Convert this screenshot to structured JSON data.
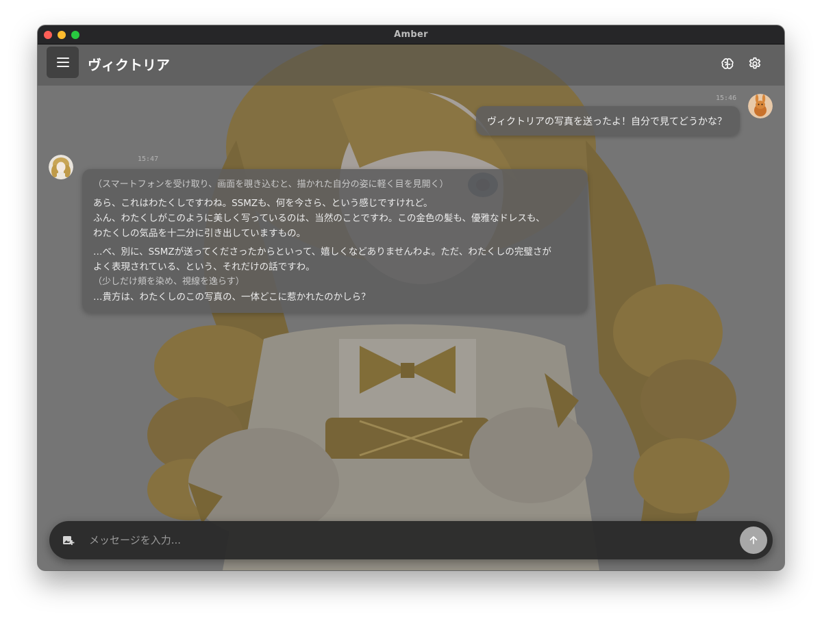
{
  "window": {
    "title": "Amber",
    "traffic_lights": {
      "close": "#fe5f57",
      "minimize": "#febc2e",
      "maximize": "#28c840"
    }
  },
  "header": {
    "title": "ヴィクトリア",
    "icons": {
      "menu": "hamburger-menu-icon",
      "brain": "brain-icon",
      "settings": "gear-icon"
    }
  },
  "messages": [
    {
      "role": "user",
      "time": "15:46",
      "text": "ヴィクトリアの写真を送ったよ！自分で見てどうかな？"
    },
    {
      "role": "assistant",
      "time": "15:47",
      "action1": "（スマートフォンを受け取り、画面を覗き込むと、描かれた自分の姿に軽く目を見開く）",
      "p1_line1": "あら、これはわたくしですわね。SSMZも、何を今さら、という感じですけれど。",
      "p1_line2": "ふん、わたくしがこのように美しく写っているのは、当然のことですわ。この金色の髪も、優雅なドレスも、",
      "p1_line3": "わたくしの気品を十二分に引き出していますもの。",
      "p2_line1": "…べ、別に、SSMZが送ってくださったからといって、嬉しくなどありませんわよ。ただ、わたくしの完璧さが",
      "p2_line2": "よく表現されている、という、それだけの話ですわ。",
      "action2": "（少しだけ頬を染め、視線を逸らす）",
      "p3_line1": "…貴方は、わたくしのこの写真の、一体どこに惹かれたのかしら？"
    }
  ],
  "composer": {
    "placeholder": "メッセージを入力...",
    "attach_icon": "add-image-icon",
    "send_icon": "arrow-up-icon"
  },
  "colors": {
    "accent_hair": "#b08a3a",
    "bubble": "#5f5f5f",
    "send_button": "#a8a8a8"
  }
}
